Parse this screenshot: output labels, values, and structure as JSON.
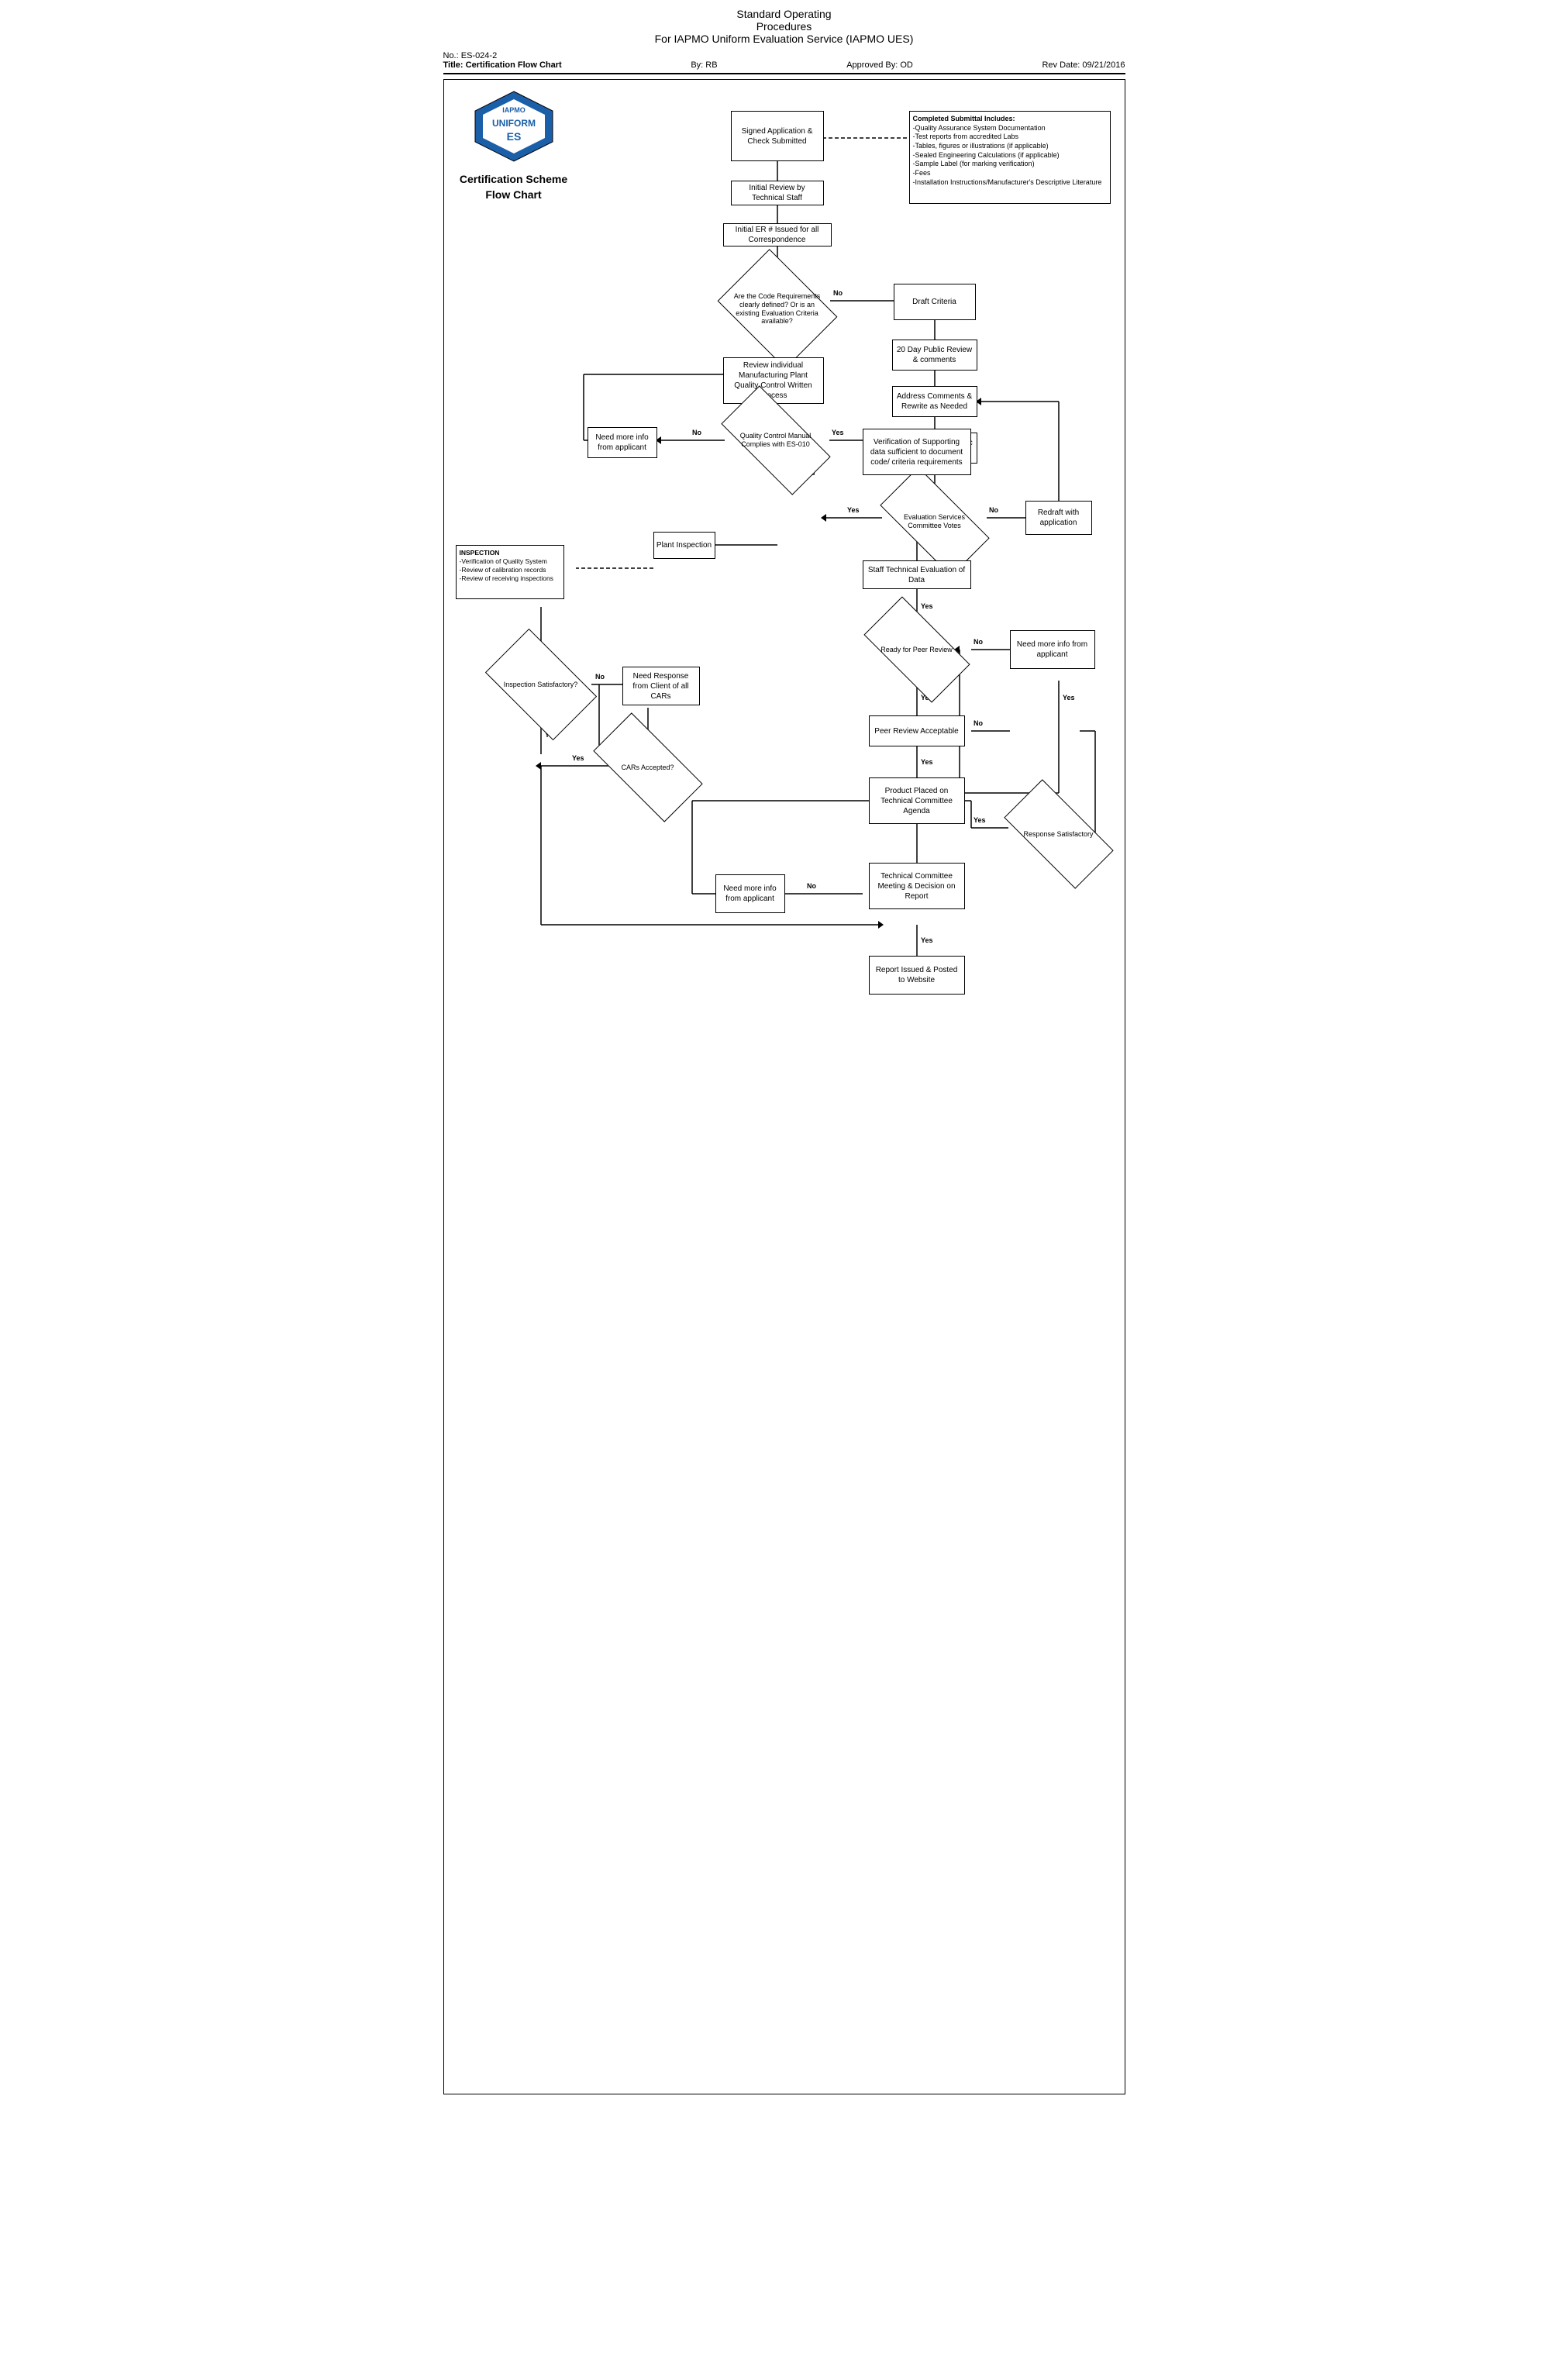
{
  "header": {
    "line1": "Standard Operating",
    "line2": "Procedures",
    "line3": "For IAPMO Uniform Evaluation Service (IAPMO UES)"
  },
  "docInfo": {
    "number": "No.: ES-024-2",
    "title": "Title: Certification Flow Chart",
    "by": "By: RB",
    "approved": "Approved By: OD",
    "revDate": "Rev Date:  09/21/2016"
  },
  "logo": {
    "title": "Certification Scheme Flow Chart"
  },
  "boxes": {
    "signedApp": "Signed Application & Check Submitted",
    "initialReview": "Initial Review by Technical Staff",
    "initialER": "Initial ER # Issued for all Correspondence",
    "draftCriteria": "Draft Criteria",
    "twentyDayReview": "20 Day Public Review & comments",
    "addressComments": "Address Comments & Rewrite as Needed",
    "second20Day": "Second 20 Day Public Review",
    "redraftApp": "Redraft with application",
    "reviewIndividual": "Review individual Manufacturing Plant Quality Control Written Process",
    "needMoreInfo1": "Need more info from applicant",
    "verification": "Verification of Supporting data sufficient to document code/ criteria requirements",
    "plantInspection": "Plant Inspection",
    "inspection": "INSPECTION\n-Verification of Quality System\n-Review of calibration records\n-Review of receiving inspections",
    "staffTech": "Staff Technical Evaluation of Data",
    "needMoreInfo2": "Need more info from applicant",
    "peerReviewAcceptable": "Peer Review Acceptable",
    "productPlaced": "Product Placed on Technical Committee Agenda",
    "needMoreInfo3": "Need more info from applicant",
    "techCommittee": "Technical Committee Meeting & Decision on Report",
    "reportIssued": "Report Issued & Posted to Website",
    "needResponse": "Need Response from Client of all CARs",
    "completedSubmittal": "Completed Submittal Includes:\n-Quality Assurance System Documentation\n-Test reports from accredited Labs\n-Tables, figures or illustrations (if applicable)\n-Sealed Engineering Calculations (if applicable)\n-Sample Label (for marking verification)\n-Fees\n-Installation Instructions/Manufacturer's Descriptive Literature",
    "responseSatisfactory": "Response Satisfactory"
  },
  "diamonds": {
    "codeReqs": "Are the Code Requirements clearly defined? Or is an existing Evaluation Criteria available?",
    "qcManual": "Quality Control Manual Complies with ES-010",
    "evalServicesCommittee": "Evaluation Services Committee Votes",
    "inspectionSatisfactory": "Inspection Satisfactory?",
    "carsAccepted": "CARs Accepted?",
    "readyForPeerReview": "Ready for Peer Review"
  },
  "labels": {
    "yes": "Yes",
    "no": "No"
  }
}
